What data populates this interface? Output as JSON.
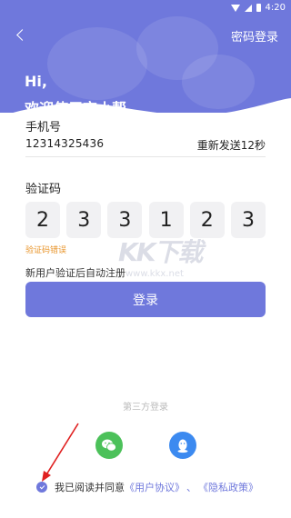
{
  "status_bar": {
    "time": "4:20"
  },
  "header": {
    "password_login": "密码登录",
    "greeting_hi": "Hi,",
    "greeting_welcome": "欢迎使用恋小帮"
  },
  "phone": {
    "label": "手机号",
    "value": "12314325436",
    "resend": "重新发送12秒"
  },
  "code": {
    "label": "验证码",
    "digits": [
      "2",
      "3",
      "3",
      "1",
      "2",
      "3"
    ],
    "error": "验证码错误"
  },
  "hint": "新用户验证后自动注册",
  "login_button": "登录",
  "watermark": {
    "logo": "KK下载",
    "url": "www.kkx.net"
  },
  "third_party": {
    "label": "第三方登录",
    "icons": [
      "wechat-icon",
      "qq-icon"
    ]
  },
  "agreement": {
    "prefix": "我已阅读并同意",
    "user_agreement": "《用户协议》",
    "separator": "、",
    "privacy_policy": "《隐私政策》"
  },
  "colors": {
    "primary": "#6f78dc",
    "error": "#e8952b",
    "wechat": "#4cc15a",
    "qq": "#3c8af0"
  }
}
